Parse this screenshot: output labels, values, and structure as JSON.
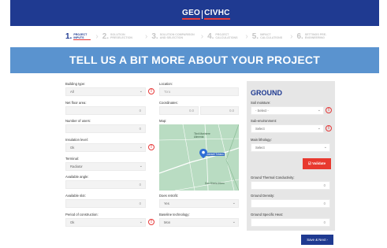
{
  "brand": {
    "logo_left": "GEO",
    "logo_right": "CIVHC"
  },
  "steps": [
    {
      "num": "1.",
      "label": "PROJECT INPUTS",
      "active": true
    },
    {
      "num": "2.",
      "label": "SOLUTION PRESELECTION",
      "active": false
    },
    {
      "num": "3.",
      "label": "SOLUTION COMPARISON AND SELECTION",
      "active": false
    },
    {
      "num": "4.",
      "label": "PROJECT CALCULATIONS",
      "active": false
    },
    {
      "num": "5.",
      "label": "IMPACT CALCULATIONS",
      "active": false
    },
    {
      "num": "6.",
      "label": "SETTINGS PRE-ENGINEERING",
      "active": false
    }
  ],
  "hero_title": "TELL US A BIT MORE ABOUT YOUR PROJECT",
  "left_fields": {
    "building_type": {
      "label": "Building type:",
      "value": "All"
    },
    "net_floor_area": {
      "label": "Net floor area:",
      "value": "0"
    },
    "number_of_users": {
      "label": "Number of users:",
      "value": "0"
    },
    "insulation_level": {
      "label": "Insulation level:",
      "value": "Ok"
    },
    "terminal": {
      "label": "Terminal:",
      "value": "Radiator"
    },
    "available_angle": {
      "label": "Available angle:",
      "value": "0"
    },
    "available_slot": {
      "label": "Available slot:",
      "value": "0"
    },
    "period_of_construction": {
      "label": "Period of construction:",
      "value": "Ok"
    }
  },
  "middle_fields": {
    "location": {
      "label": "Location:",
      "value": "Tora"
    },
    "coordinates": {
      "label": "Coordinates:",
      "lat": "0.0",
      "lon": "0.0"
    },
    "map_label": "Map:",
    "map_place_labels": [
      "Tilnit Mariniere Alimenta",
      "Dansell Tobaco",
      "Dan Dinnia Intern"
    ],
    "heat_transfer_system": {
      "label": "Does retrofit:",
      "value": "Yes"
    },
    "baseline_technology": {
      "label": "Baseline technology:",
      "value": "Mon"
    }
  },
  "ground": {
    "title": "GROUND",
    "soil_moisture": {
      "label": "Soil moisture:",
      "value": "- Select -"
    },
    "sub_environment": {
      "label": "Sub-environment:",
      "value": "Select"
    },
    "main_lithology": {
      "label": "Main lithology:",
      "value": "Select"
    },
    "validate_label": "Validate",
    "thermal_conductivity": {
      "label": "Ground Thermal Conductivity:",
      "value": "0"
    },
    "density": {
      "label": "Ground Density:",
      "value": "0"
    },
    "specific_heat": {
      "label": "Ground Specific Heat:",
      "value": "0"
    }
  },
  "save_label": "Save & Next ›",
  "colors": {
    "primary": "#1f3a91",
    "accent": "#e73a3a",
    "hero": "#5a93cf"
  }
}
